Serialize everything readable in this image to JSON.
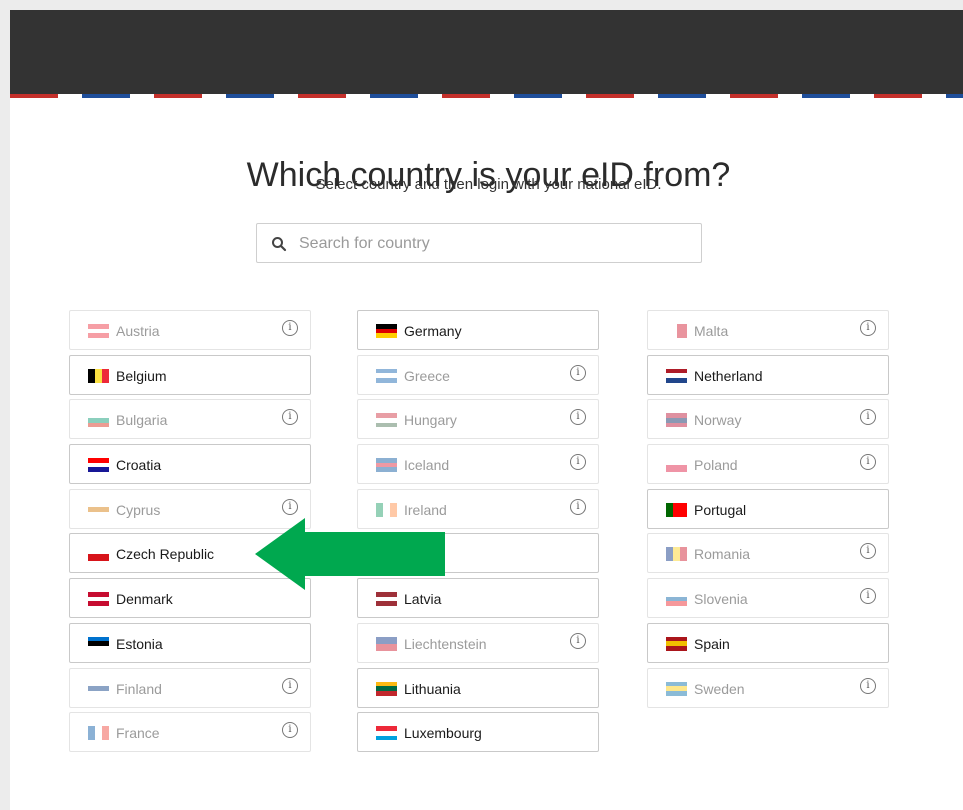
{
  "header": {
    "title": "Which country is your eID from?",
    "subtitle": "Select country and then login with your national eID."
  },
  "search": {
    "placeholder": "Search for country",
    "icon": "search-icon"
  },
  "info_icon_glyph": "i",
  "columns": [
    [
      {
        "name": "Austria",
        "enabled": false,
        "info": true,
        "flag_colors": [
          "#ed2939",
          "#ffffff",
          "#ed2939"
        ],
        "flag_dir": "v"
      },
      {
        "name": "Belgium",
        "enabled": true,
        "info": false,
        "flag_colors": [
          "#000000",
          "#fae042",
          "#ed2939"
        ],
        "flag_dir": "h"
      },
      {
        "name": "Bulgaria",
        "enabled": false,
        "info": true,
        "flag_colors": [
          "#ffffff",
          "#00966e",
          "#d62612"
        ],
        "flag_dir": "v"
      },
      {
        "name": "Croatia",
        "enabled": true,
        "info": false,
        "flag_colors": [
          "#ff0000",
          "#ffffff",
          "#171796"
        ],
        "flag_dir": "v"
      },
      {
        "name": "Cyprus",
        "enabled": false,
        "info": true,
        "flag_colors": [
          "#ffffff",
          "#d57800",
          "#ffffff"
        ],
        "flag_dir": "v"
      },
      {
        "name": "Czech Republic",
        "enabled": true,
        "info": false,
        "flag_colors": [
          "#ffffff",
          "#d7141a"
        ],
        "flag_dir": "v"
      },
      {
        "name": "Denmark",
        "enabled": true,
        "info": false,
        "flag_colors": [
          "#c60c30",
          "#ffffff",
          "#c60c30"
        ],
        "flag_dir": "v"
      },
      {
        "name": "Estonia",
        "enabled": true,
        "info": false,
        "flag_colors": [
          "#0072ce",
          "#000000",
          "#ffffff"
        ],
        "flag_dir": "v"
      },
      {
        "name": "Finland",
        "enabled": false,
        "info": true,
        "flag_colors": [
          "#ffffff",
          "#003580",
          "#ffffff"
        ],
        "flag_dir": "v"
      },
      {
        "name": "France",
        "enabled": false,
        "info": true,
        "flag_colors": [
          "#0055a4",
          "#ffffff",
          "#ef4135"
        ],
        "flag_dir": "h"
      }
    ],
    [
      {
        "name": "Germany",
        "enabled": true,
        "info": false,
        "flag_colors": [
          "#000000",
          "#dd0000",
          "#ffce00"
        ],
        "flag_dir": "v"
      },
      {
        "name": "Greece",
        "enabled": false,
        "info": true,
        "flag_colors": [
          "#0d5eaf",
          "#ffffff",
          "#0d5eaf"
        ],
        "flag_dir": "v"
      },
      {
        "name": "Hungary",
        "enabled": false,
        "info": true,
        "flag_colors": [
          "#ce2939",
          "#ffffff",
          "#477050"
        ],
        "flag_dir": "v"
      },
      {
        "name": "Iceland",
        "enabled": false,
        "info": true,
        "flag_colors": [
          "#02529c",
          "#dc1e35",
          "#02529c"
        ],
        "flag_dir": "v"
      },
      {
        "name": "Ireland",
        "enabled": false,
        "info": true,
        "flag_colors": [
          "#169b62",
          "#ffffff",
          "#ff883e"
        ],
        "flag_dir": "h"
      },
      {
        "name": "",
        "enabled": true,
        "info": false,
        "flag_colors": [],
        "flag_dir": "v"
      },
      {
        "name": "Latvia",
        "enabled": true,
        "info": false,
        "flag_colors": [
          "#9e3039",
          "#ffffff",
          "#9e3039"
        ],
        "flag_dir": "v"
      },
      {
        "name": "Liechtenstein",
        "enabled": false,
        "info": true,
        "flag_colors": [
          "#002b7f",
          "#ce1126"
        ],
        "flag_dir": "v"
      },
      {
        "name": "Lithuania",
        "enabled": true,
        "info": false,
        "flag_colors": [
          "#fdb913",
          "#006a44",
          "#c1272d"
        ],
        "flag_dir": "v"
      },
      {
        "name": "Luxembourg",
        "enabled": true,
        "info": false,
        "flag_colors": [
          "#ed2939",
          "#ffffff",
          "#00a1de"
        ],
        "flag_dir": "v"
      }
    ],
    [
      {
        "name": "Malta",
        "enabled": false,
        "info": true,
        "flag_colors": [
          "#ffffff",
          "#cf142b"
        ],
        "flag_dir": "h"
      },
      {
        "name": "Netherland",
        "enabled": true,
        "info": false,
        "flag_colors": [
          "#ae1c28",
          "#ffffff",
          "#21468b"
        ],
        "flag_dir": "v"
      },
      {
        "name": "Norway",
        "enabled": false,
        "info": true,
        "flag_colors": [
          "#ba0c2f",
          "#00205b",
          "#ba0c2f"
        ],
        "flag_dir": "v"
      },
      {
        "name": "Poland",
        "enabled": false,
        "info": true,
        "flag_colors": [
          "#ffffff",
          "#dc143c"
        ],
        "flag_dir": "v"
      },
      {
        "name": "Portugal",
        "enabled": true,
        "info": false,
        "flag_colors": [
          "#006600",
          "#ff0000",
          "#ff0000"
        ],
        "flag_dir": "h"
      },
      {
        "name": "Romania",
        "enabled": false,
        "info": true,
        "flag_colors": [
          "#002b7f",
          "#fcd116",
          "#ce1126"
        ],
        "flag_dir": "h"
      },
      {
        "name": "Slovenia",
        "enabled": false,
        "info": true,
        "flag_colors": [
          "#ffffff",
          "#005da4",
          "#ed1c24"
        ],
        "flag_dir": "v"
      },
      {
        "name": "Spain",
        "enabled": true,
        "info": false,
        "flag_colors": [
          "#aa151b",
          "#f1bf00",
          "#aa151b"
        ],
        "flag_dir": "v"
      },
      {
        "name": "Sweden",
        "enabled": false,
        "info": true,
        "flag_colors": [
          "#006aa7",
          "#fecc00",
          "#006aa7"
        ],
        "flag_dir": "v"
      }
    ]
  ],
  "annotation": {
    "arrow_color": "#00a84f"
  }
}
